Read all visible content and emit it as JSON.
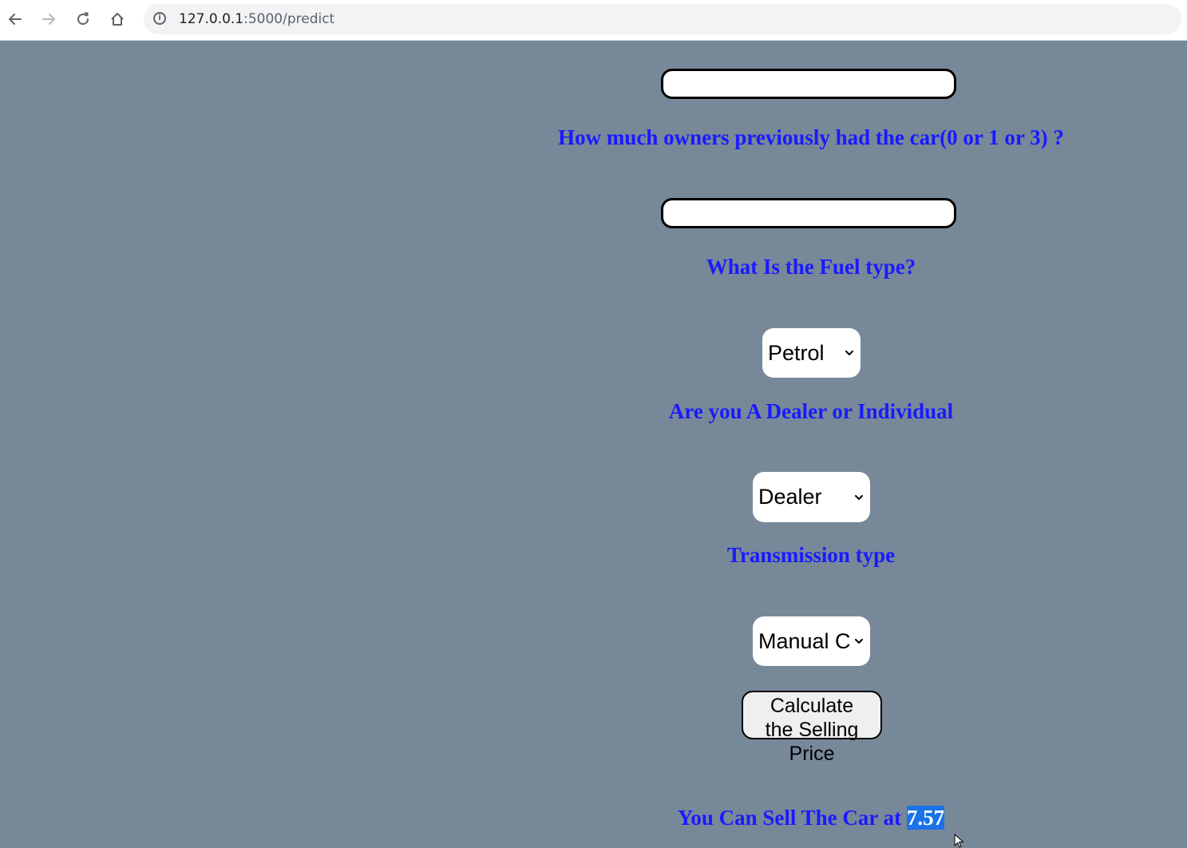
{
  "browser": {
    "back_icon": "arrow-left-icon",
    "forward_icon": "arrow-right-icon",
    "reload_icon": "reload-icon",
    "home_icon": "home-icon",
    "info_icon": "info-icon",
    "url_host": "127.0.0.1",
    "url_rest": ":5000/predict"
  },
  "form": {
    "owners_label": "How much owners previously had the car(0 or 1 or 3) ?",
    "owners_value": "",
    "fuel_label": "What Is the Fuel type?",
    "fuel_selected": "Petrol",
    "seller_label": "Are you A Dealer or Individual",
    "seller_selected": "Dealer",
    "transmission_label": "Transmission type",
    "transmission_selected": "Manual C",
    "submit_line1": "Calculate",
    "submit_line2": "the Selling",
    "submit_line3": "Price"
  },
  "result": {
    "prefix": "You Can Sell The Car at ",
    "value": "7.57"
  },
  "colors": {
    "background": "#778899",
    "label_text": "#1a1aff",
    "selection_highlight": "#1a73e8"
  }
}
